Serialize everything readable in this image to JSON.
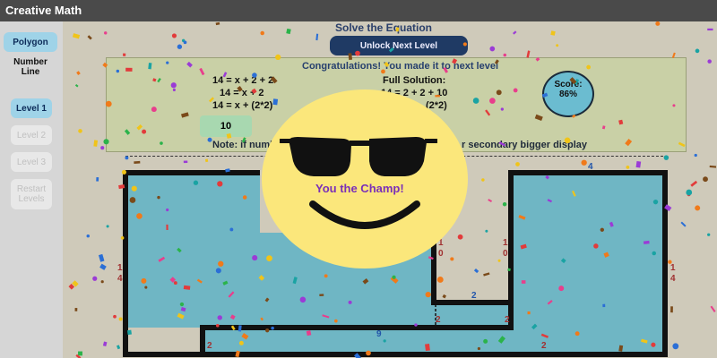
{
  "app": {
    "title": "Creative Math"
  },
  "sidebar": {
    "items": [
      {
        "label": "Polygon"
      },
      {
        "label": "Number Line"
      },
      {
        "label": "Level 1"
      },
      {
        "label": "Level 2"
      },
      {
        "label": "Level 3"
      },
      {
        "label": "Restart Levels"
      }
    ]
  },
  "main": {
    "heading": "Solve the Equation",
    "unlock_label": "Unlock Next Level",
    "panel": {
      "congrats": "Congratulations! You made it to next level",
      "equations": [
        "14 = x + 2 + 2",
        "14 = x + 2",
        "14 = x + (2*2)"
      ],
      "solution_title": "Full Solution:",
      "solution_lines": [
        "14 = 2 + 2 + 10",
        "(2*2)"
      ],
      "answer": "10",
      "note_left": "Note: if numb",
      "note_right": "r secondary bigger display",
      "score_label": "Score:",
      "score_value": "86%"
    },
    "dims": {
      "top": "4",
      "left1": "1",
      "left2": "4",
      "right1": "1",
      "right2": "4",
      "inner_l1": "1",
      "inner_l2": "0",
      "inner_r1": "1",
      "inner_r2": "0",
      "notch": "2",
      "dash_left": "2",
      "dash_right": "2",
      "bottom": "9",
      "step_left": "2",
      "step_right": "2"
    }
  },
  "overlay": {
    "message": "You the Champ!"
  },
  "colors": {
    "shape_fill": "#6fb6c4",
    "smiley_yellow": "#fbe77b",
    "message": "#7a2fb8"
  }
}
